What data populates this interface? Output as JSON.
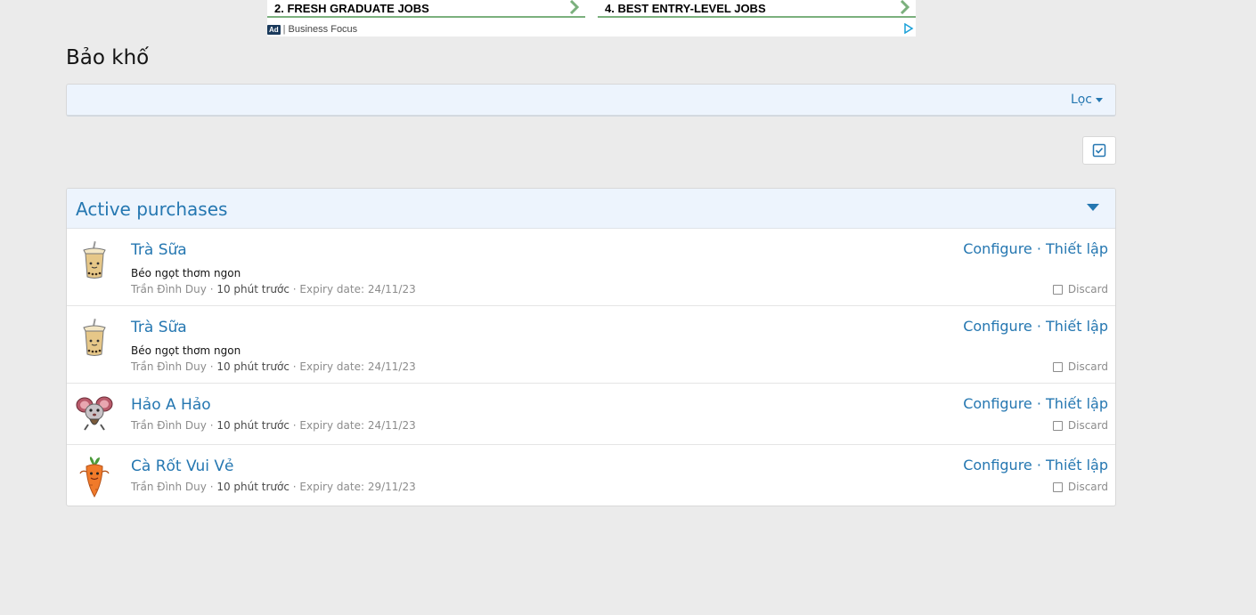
{
  "ad": {
    "links": [
      {
        "number": "2.",
        "text": "FRESH GRADUATE JOBS"
      },
      {
        "number": "4.",
        "text": "BEST ENTRY-LEVEL JOBS"
      }
    ],
    "badge": "Ad",
    "separator": "|",
    "source": "Business Focus",
    "accent_color": "#7bb07d"
  },
  "page": {
    "title": "Bảo khố"
  },
  "filter": {
    "label": "Lọc"
  },
  "block": {
    "title": "Active purchases",
    "accent_color": "#2577b1",
    "items": [
      {
        "avatar": "bubble-tea-icon",
        "title": "Trà Sữa",
        "description": "Béo ngọt thơm ngon",
        "author": "Trần Đình Duy",
        "separator1": " · ",
        "time": "10 phút trước",
        "separator2": " · ",
        "expiry": "Expiry date: 24/11/23",
        "configure": "Configure",
        "action_sep": " · ",
        "setup": "Thiết lập",
        "discard": "Discard"
      },
      {
        "avatar": "bubble-tea-icon",
        "title": "Trà Sữa",
        "description": "Béo ngọt thơm ngon",
        "author": "Trần Đình Duy",
        "separator1": " · ",
        "time": "10 phút trước",
        "separator2": " · ",
        "expiry": "Expiry date: 24/11/23",
        "configure": "Configure",
        "action_sep": " · ",
        "setup": "Thiết lập",
        "discard": "Discard"
      },
      {
        "avatar": "mouse-icon",
        "title": "Hảo A Hảo",
        "author": "Trần Đình Duy",
        "separator1": " · ",
        "time": "10 phút trước",
        "separator2": " · ",
        "expiry": "Expiry date: 24/11/23",
        "configure": "Configure",
        "action_sep": " · ",
        "setup": "Thiết lập",
        "discard": "Discard"
      },
      {
        "avatar": "carrot-icon",
        "title": "Cà Rốt Vui Vẻ",
        "author": "Trần Đình Duy",
        "separator1": " · ",
        "time": "10 phút trước",
        "separator2": " · ",
        "expiry": "Expiry date: 29/11/23",
        "configure": "Configure",
        "action_sep": " · ",
        "setup": "Thiết lập",
        "discard": "Discard"
      }
    ]
  }
}
